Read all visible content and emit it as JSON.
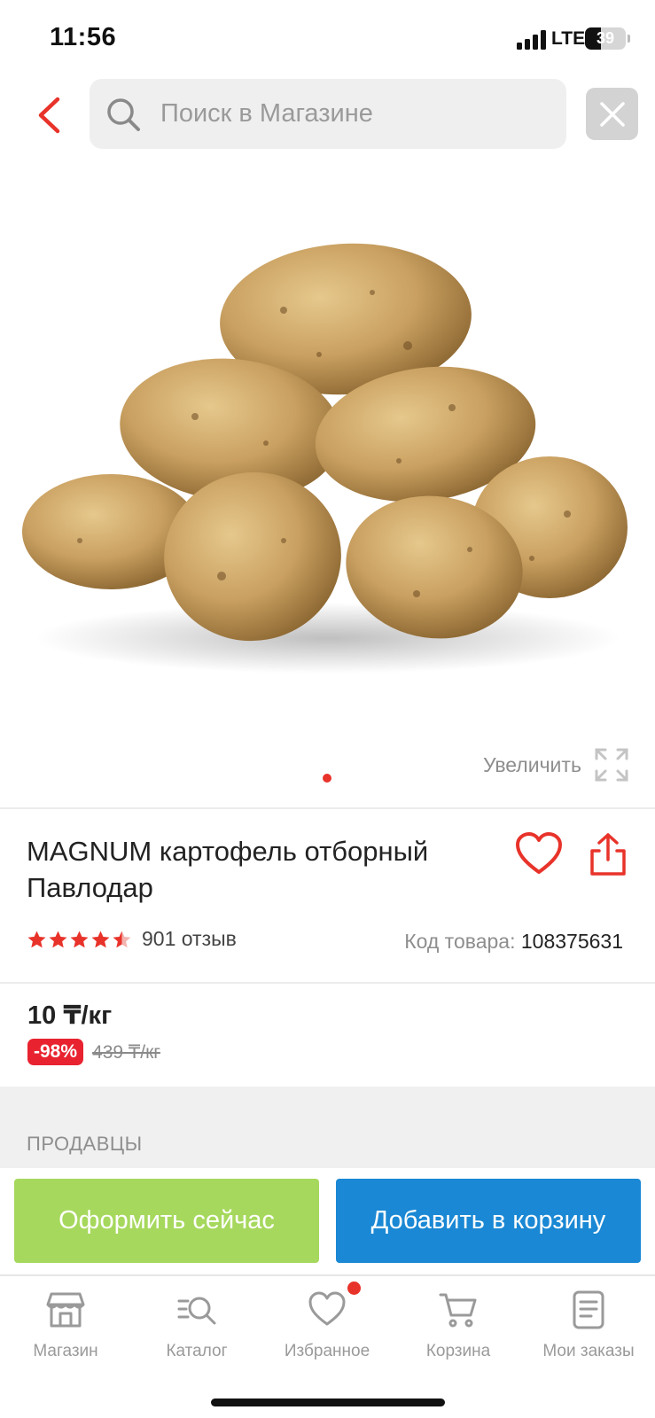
{
  "status_bar": {
    "time": "11:56",
    "network": "LTE",
    "battery": "39",
    "battery_level": 0.39
  },
  "header": {
    "search_placeholder": "Поиск в Магазине"
  },
  "gallery": {
    "zoom_label": "Увеличить",
    "image_count": 1,
    "active_index": 0
  },
  "product": {
    "title": "MAGNUM картофель отборный Павлодар",
    "rating": 4.5,
    "reviews": "901 отзыв",
    "code_label": "Код товара:",
    "code_value": "108375631"
  },
  "price": {
    "current": "10 ₸/кг",
    "discount": "-98%",
    "old": "439 ₸/кг"
  },
  "sellers": {
    "heading": "ПРОДАВЦЫ"
  },
  "actions": {
    "buy_now": "Оформить сейчас",
    "add_to_cart": "Добавить в корзину"
  },
  "tabs": [
    {
      "label": "Магазин",
      "icon": "store-icon"
    },
    {
      "label": "Каталог",
      "icon": "catalog-icon"
    },
    {
      "label": "Избранное",
      "icon": "heart-icon",
      "has_badge": true
    },
    {
      "label": "Корзина",
      "icon": "cart-icon"
    },
    {
      "label": "Мои заказы",
      "icon": "orders-icon"
    }
  ],
  "colors": {
    "accent_red": "#e8332a",
    "buy_green": "#a6d85d",
    "cart_blue": "#1a88d4"
  }
}
